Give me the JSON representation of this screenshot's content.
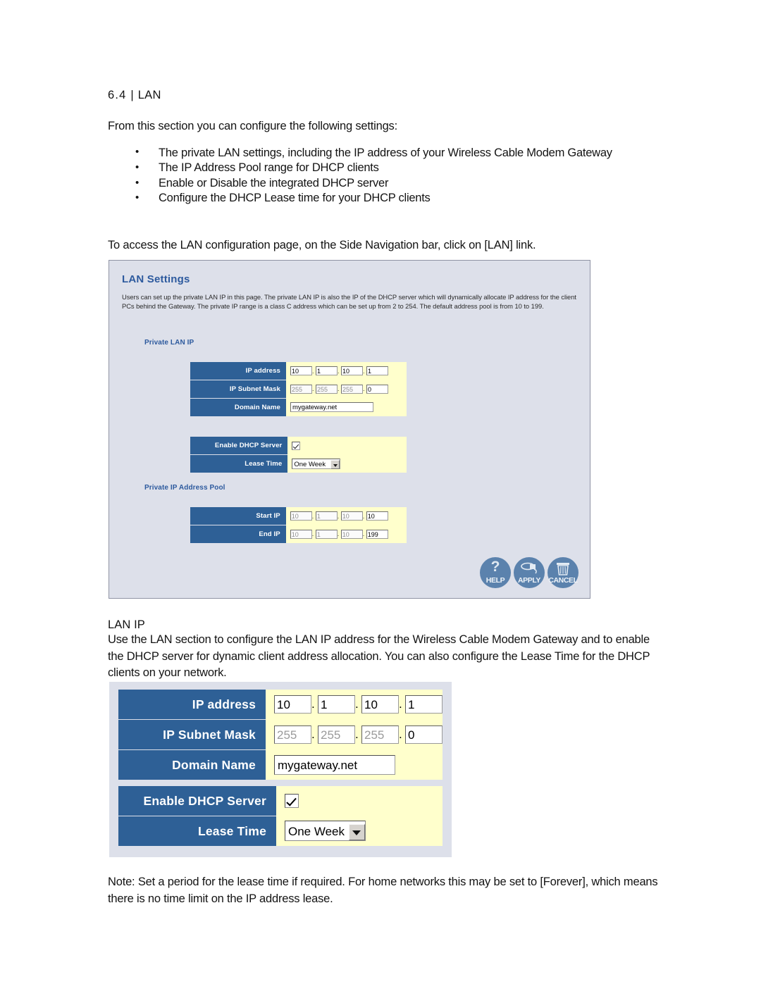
{
  "document": {
    "section_heading_number": "6.4 |",
    "section_heading_title": "LAN",
    "intro": "From this section you can configure the following settings:",
    "bullets": [
      "The private LAN settings, including the IP address of your Wireless Cable Modem Gateway",
      "The IP Address Pool range for DHCP clients",
      "Enable or Disable the integrated DHCP server",
      "Configure the DHCP Lease time for your DHCP clients"
    ],
    "access_line": "To access the LAN configuration page, on the Side Navigation bar, click on [LAN] link.",
    "lanip_heading": "LAN IP",
    "lanip_paragraph": "Use the LAN section to configure the LAN IP address for the Wireless Cable Modem Gateway and to enable the DHCP server for dynamic client address allocation. You can also configure the Lease Time for the DHCP clients on your network.",
    "note_paragraph": "Note: Set a period for the lease time if required. For home networks this may be set to [Forever], which means there is no time limit on the IP address lease."
  },
  "lan_panel": {
    "title": "LAN Settings",
    "description": "Users can set up the private LAN IP in this page. The private LAN IP is also the IP of the DHCP server which will dynamically allocate IP address for the client PCs behind the Gateway. The private IP range is a class C address which can be set up from 2 to 254. The default address pool is from 10 to 199.",
    "subheading_private_lan_ip": "Private LAN IP",
    "subheading_private_pool": "Private IP Address Pool",
    "fields": {
      "ip_address": {
        "label": "IP address",
        "octets": [
          "10",
          "1",
          "10",
          "1"
        ]
      },
      "ip_subnet_mask": {
        "label": "IP Subnet Mask",
        "octets": [
          "255",
          "255",
          "255",
          "0"
        ]
      },
      "domain_name": {
        "label": "Domain Name",
        "value": "mygateway.net"
      },
      "enable_dhcp_server": {
        "label": "Enable DHCP Server",
        "checked": true
      },
      "lease_time": {
        "label": "Lease Time",
        "value": "One Week"
      },
      "start_ip": {
        "label": "Start IP",
        "octets": [
          "10",
          "1",
          "10",
          "10"
        ]
      },
      "end_ip": {
        "label": "End IP",
        "octets": [
          "10",
          "1",
          "10",
          "199"
        ]
      }
    },
    "buttons": [
      {
        "caption": "HELP",
        "icon": "question-mark-icon"
      },
      {
        "caption": "APPLY",
        "icon": "disk-icon"
      },
      {
        "caption": "CANCEL",
        "icon": "trash-can-icon"
      }
    ],
    "separator": "."
  },
  "colors": {
    "label_blue": "#2e6096",
    "field_yellow": "#ffffcc",
    "panel_background": "#dde0ea",
    "heading_blue": "#2d5a9e",
    "button_blue": "#5b82ad"
  }
}
